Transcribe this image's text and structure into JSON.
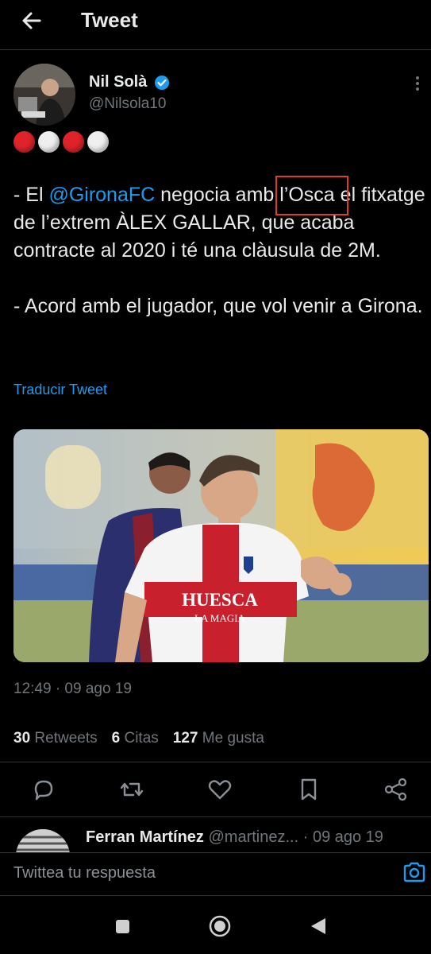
{
  "header": {
    "title": "Tweet"
  },
  "author": {
    "name": "Nil Solà",
    "handle": "@Nilsola10",
    "verified": true
  },
  "tweet": {
    "emoji": [
      "red-circle",
      "white-circle",
      "red-circle",
      "white-circle"
    ],
    "line1_pre": "- El ",
    "line1_mention": "@GironaFC",
    "line1_mid": " negocia amb ",
    "line1_boxed": "l’Osca",
    "line1_post": " el fitxatge de l’extrem ÀLEX GALLAR, que acaba contracte al 2020 i té una clàusula de 2M.",
    "line2": "- Acord amb el jugador, que vol venir a Girona.",
    "translate_label": "Traducir Tweet",
    "image_alt_text": "HUESCA LA MAGIA",
    "timestamp": "12:49 · 09 ago 19"
  },
  "stats": {
    "retweets_count": "30",
    "retweets_label": "Retweets",
    "quotes_count": "6",
    "quotes_label": "Citas",
    "likes_count": "127",
    "likes_label": "Me gusta"
  },
  "reply_preview": {
    "name": "Ferran Martínez",
    "handle": "@martinez...",
    "date": "· 09 ago 19"
  },
  "composer": {
    "placeholder": "Twittea tu respuesta"
  },
  "colors": {
    "accent": "#1d9bf0",
    "highlight_box": "#e03c2c"
  }
}
